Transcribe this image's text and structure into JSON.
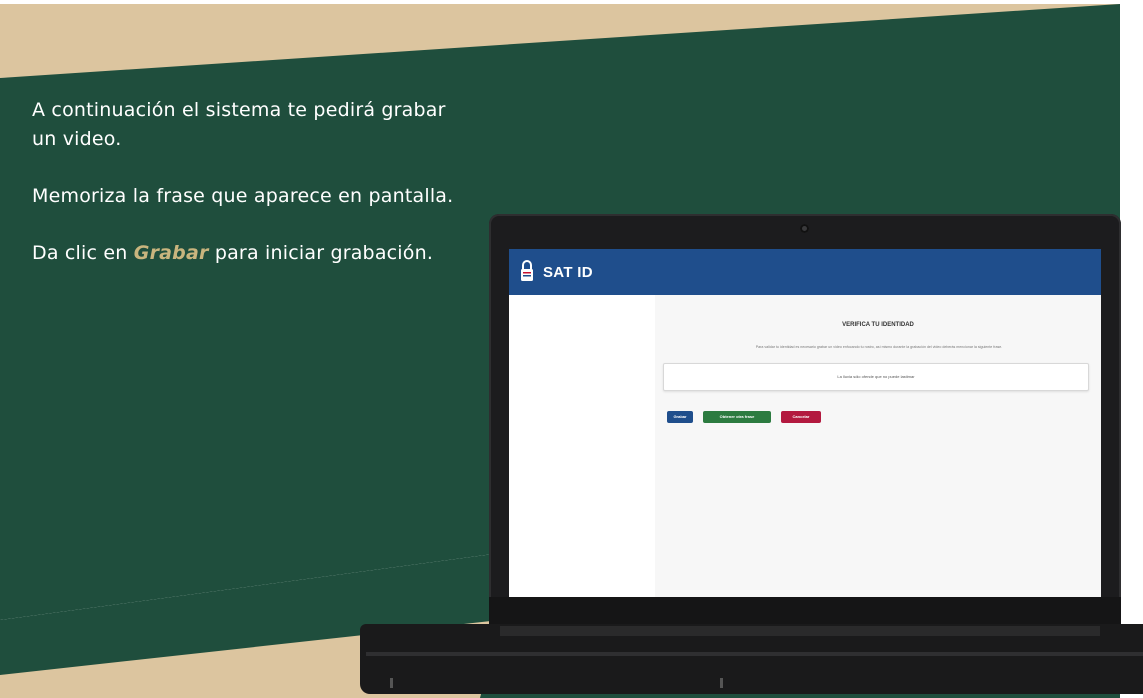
{
  "slide": {
    "colors": {
      "background_green": "#1f4e3d",
      "band_tan": "#dcc59f",
      "highlight_gold": "#c9b57e",
      "text_white": "#ffffff"
    },
    "instruction_1": "A continuación el sistema te pedirá grabar un video.",
    "instruction_2": "Memoriza la frase que aparece en pantalla.",
    "instruction_3_prefix": "Da clic en",
    "instruction_3_highlight": "Grabar",
    "instruction_3_suffix": "para iniciar grabación."
  },
  "app": {
    "brand": "SAT ID",
    "header_color": "#1f4e8c",
    "brand_icon": "lock-icon",
    "verify_title": "VERIFICA TU IDENTIDAD",
    "verify_description": "Para validar tu identidad es necesario grabar un video enfocando tu rostro, así mismo durante la grabación del video deberás mencionar la siguiente frase.",
    "phrase": "La lluvia sólo ofende que no puede lastimar",
    "buttons": {
      "record": "Grabar",
      "other_phrase": "Obtener otra frase",
      "cancel": "Cancelar"
    },
    "button_colors": {
      "record": "#1f4e8c",
      "other_phrase": "#2c7b40",
      "cancel": "#b3193f"
    }
  }
}
